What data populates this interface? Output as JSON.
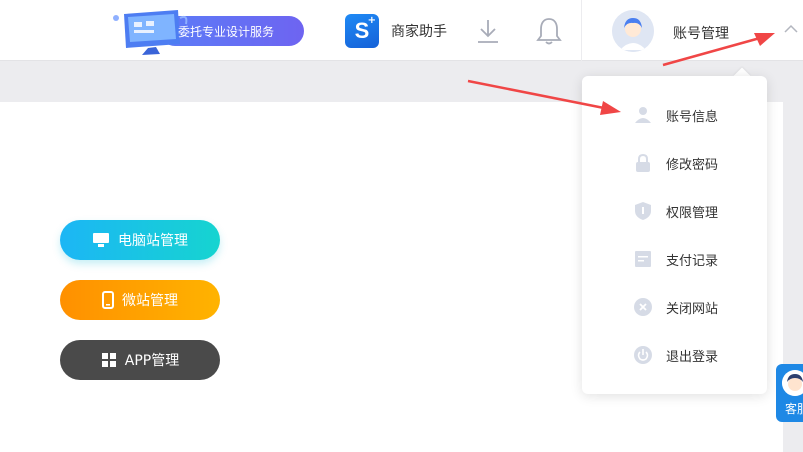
{
  "header": {
    "promo_label": "委托专业设计服务",
    "assistant_label": "商家助手",
    "account_label": "账号管理"
  },
  "main": {
    "buttons": [
      {
        "label": "电脑站管理",
        "icon": "monitor-icon"
      },
      {
        "label": "微站管理",
        "icon": "phone-icon"
      },
      {
        "label": "APP管理",
        "icon": "grid-icon"
      }
    ]
  },
  "dropdown": {
    "items": [
      {
        "label": "账号信息",
        "icon": "user-icon"
      },
      {
        "label": "修改密码",
        "icon": "lock-icon"
      },
      {
        "label": "权限管理",
        "icon": "shield-icon"
      },
      {
        "label": "支付记录",
        "icon": "document-icon"
      },
      {
        "label": "关闭网站",
        "icon": "close-circle-icon"
      },
      {
        "label": "退出登录",
        "icon": "power-icon"
      }
    ]
  },
  "service": {
    "label": "客服"
  },
  "colors": {
    "accent_blue": "#1e88e5",
    "pc_button": "#1cb6f5",
    "mobile_button": "#ff9000",
    "app_button": "#4a4a4a",
    "annotation_arrow": "#f04646"
  }
}
